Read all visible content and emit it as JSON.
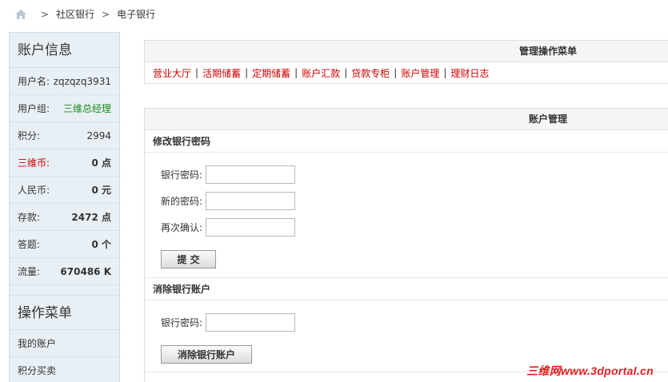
{
  "breadcrumb": {
    "items": [
      "社区银行",
      "电子银行"
    ],
    "separator": ">"
  },
  "sidebar": {
    "account_title": "账户信息",
    "info": [
      {
        "label": "用户名:",
        "value": "zqzqzq3931"
      },
      {
        "label": "用户组:",
        "value": "三维总经理"
      },
      {
        "label": "积分:",
        "value": "2994"
      },
      {
        "label": "三维币:",
        "value": "0 点"
      },
      {
        "label": "人民币:",
        "value": "0 元"
      },
      {
        "label": "存款:",
        "value": "2472 点"
      },
      {
        "label": "答题:",
        "value": "0 个"
      },
      {
        "label": "流量:",
        "value": "670486 K"
      }
    ],
    "menu_title": "操作菜单",
    "menu": [
      "我的账户",
      "积分买卖"
    ]
  },
  "top_panel": {
    "title": "管理操作菜单",
    "nav": [
      "营业大厅",
      "活期储蓄",
      "定期储蓄",
      "账户汇款",
      "贷款专柜",
      "账户管理",
      "理财日志"
    ],
    "pipe": "|"
  },
  "account_panel": {
    "title": "账户管理",
    "change_password": {
      "heading": "修改银行密码",
      "fields": [
        {
          "label": "银行密码:",
          "value": ""
        },
        {
          "label": "新的密码:",
          "value": ""
        },
        {
          "label": "再次确认:",
          "value": ""
        }
      ],
      "submit_label": "提 交"
    },
    "delete_account": {
      "heading": "消除银行账户",
      "field_label": "银行密码:",
      "field_value": "",
      "button_label": "消除银行账户"
    }
  },
  "watermark": "三维网www.3dportal.cn",
  "colors": {
    "link_red": "#cc0000",
    "group_green": "#1a8c1a",
    "sidebar_bg": "#e8eff5"
  }
}
